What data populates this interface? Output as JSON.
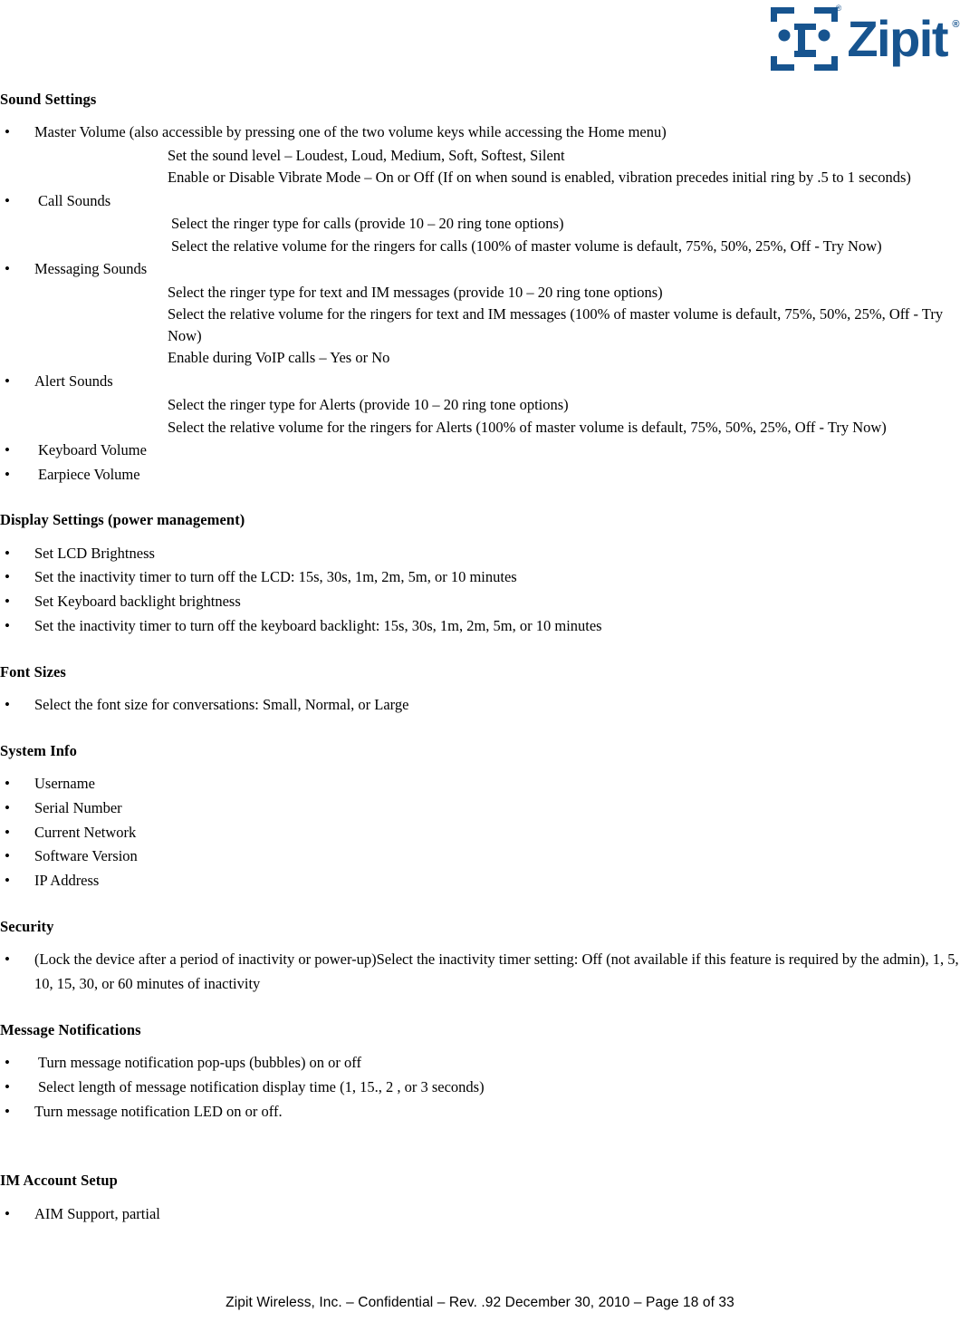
{
  "header": {
    "logo_wordmark": "Zipit",
    "logo_registered_mark": "®",
    "logo_icon_name": "zipit-z-face-logo",
    "brand_color": "#17548F"
  },
  "sections": [
    {
      "heading": "Sound Settings",
      "bullets": [
        {
          "text": "Master Volume (also accessible by pressing one of the two volume keys while accessing the Home menu)",
          "sub": [
            "Set the sound level – Loudest, Loud, Medium, Soft, Softest, Silent",
            "Enable or Disable Vibrate Mode – On or Off (If on when sound is enabled, vibration precedes initial ring by .5 to 1 seconds)"
          ]
        },
        {
          "text": " Call Sounds",
          "sub": [
            "Select the ringer type for calls (provide 10 – 20 ring tone options)",
            "Select the relative volume for the ringers for calls (100% of master volume is default, 75%, 50%, 25%, Off - Try Now)"
          ]
        },
        {
          "text": "Messaging Sounds",
          "sub": [
            "Select the ringer type for text and IM messages (provide 10 – 20 ring tone options)",
            "Select the relative volume for the ringers for text and IM messages (100% of master volume is default, 75%, 50%, 25%, Off - Try Now)",
            "Enable during VoIP calls – Yes or No"
          ]
        },
        {
          "text": "Alert Sounds",
          "sub": [
            "Select the ringer type for Alerts (provide 10 – 20 ring tone options)",
            "Select the relative volume for the ringers for Alerts (100% of master volume is default, 75%, 50%, 25%, Off - Try Now)"
          ]
        },
        {
          "text": " Keyboard Volume",
          "sub": []
        },
        {
          "text": " Earpiece Volume",
          "sub": []
        }
      ]
    },
    {
      "heading": "Display Settings (power management)",
      "bullets": [
        {
          "text": "Set LCD Brightness",
          "sub": []
        },
        {
          "text": "Set the inactivity timer to turn off the LCD: 15s, 30s, 1m, 2m, 5m, or 10 minutes",
          "sub": []
        },
        {
          "text": "Set Keyboard backlight brightness",
          "sub": []
        },
        {
          "text": "Set the inactivity timer to turn off the keyboard backlight: 15s, 30s, 1m, 2m, 5m, or 10 minutes",
          "sub": []
        }
      ]
    },
    {
      "heading": "Font Sizes",
      "bullets": [
        {
          "text": "Select the font size for conversations: Small, Normal, or Large",
          "sub": []
        }
      ]
    },
    {
      "heading": "System Info",
      "bullets": [
        {
          "text": "Username",
          "sub": []
        },
        {
          "text": "Serial Number",
          "sub": []
        },
        {
          "text": "Current Network",
          "sub": []
        },
        {
          "text": "Software Version",
          "sub": []
        },
        {
          "text": "IP Address",
          "sub": []
        }
      ]
    },
    {
      "heading": "Security",
      "bullets": [
        {
          "text": "(Lock the device after a period of inactivity or power-up)Select the inactivity timer setting: Off (not available if this feature is required by the admin), 1, 5, 10, 15, 30, or 60 minutes of inactivity",
          "sub": []
        }
      ]
    },
    {
      "heading": "Message Notifications",
      "bullets": [
        {
          "text": " Turn message notification pop-ups (bubbles) on or off",
          "sub": []
        },
        {
          "text": " Select length of message notification display time (1, 15., 2 , or 3 seconds)",
          "sub": []
        },
        {
          "text": "Turn message notification LED on or off.",
          "sub": []
        }
      ]
    },
    {
      "heading": "IM Account Setup",
      "bullets": [
        {
          "text": "AIM Support, partial",
          "sub": []
        }
      ]
    }
  ],
  "footer": {
    "text": "Zipit Wireless, Inc. – Confidential – Rev. .92 December 30, 2010 – Page 18 of 33"
  }
}
